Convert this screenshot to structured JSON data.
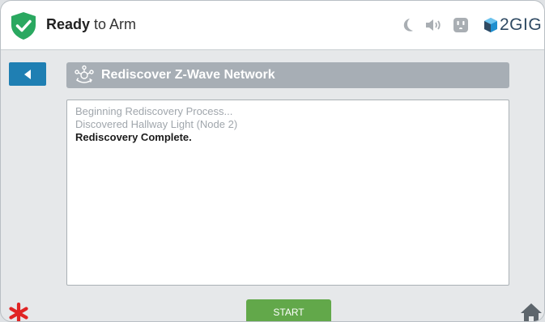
{
  "status": {
    "state_bold": "Ready",
    "state_rest": " to Arm",
    "state_color": "#2aa860"
  },
  "brand": {
    "name": "2GIG"
  },
  "header_icons": [
    "moon-icon",
    "speaker-icon",
    "outlet-icon"
  ],
  "page": {
    "title": "Rediscover Z-Wave Network"
  },
  "log": {
    "lines": [
      "Beginning Rediscovery Process...",
      "Discovered Hallway Light (Node 2)",
      "Rediscovery Complete."
    ]
  },
  "actions": {
    "start_label": "START"
  },
  "colors": {
    "back_button": "#1f7fb3",
    "title_bar": "#a7aeb5",
    "start_button": "#62a84a",
    "emergency": "#e02424"
  }
}
